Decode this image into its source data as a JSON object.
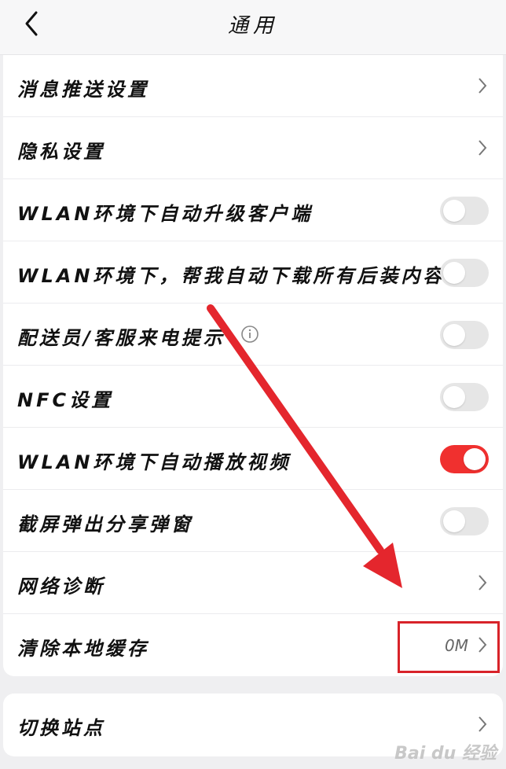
{
  "header": {
    "title": "通用"
  },
  "rows": [
    {
      "label": "消息推送设置"
    },
    {
      "label": "隐私设置"
    },
    {
      "label": "WLAN环境下自动升级客户端"
    },
    {
      "label": "WLAN环境下，帮我自动下载所有后装内容"
    },
    {
      "label": "配送员/客服来电提示"
    },
    {
      "label": "NFC设置"
    },
    {
      "label": "WLAN环境下自动播放视频"
    },
    {
      "label": "截屏弹出分享弹窗"
    },
    {
      "label": "网络诊断"
    },
    {
      "label": "清除本地缓存",
      "value": "0M"
    }
  ],
  "site_row": {
    "label": "切换站点"
  },
  "watermark": "Bai du 经验",
  "colors": {
    "accent": "#f0302f",
    "highlight": "#d8232a",
    "toggle_off": "#e6e6e6"
  }
}
